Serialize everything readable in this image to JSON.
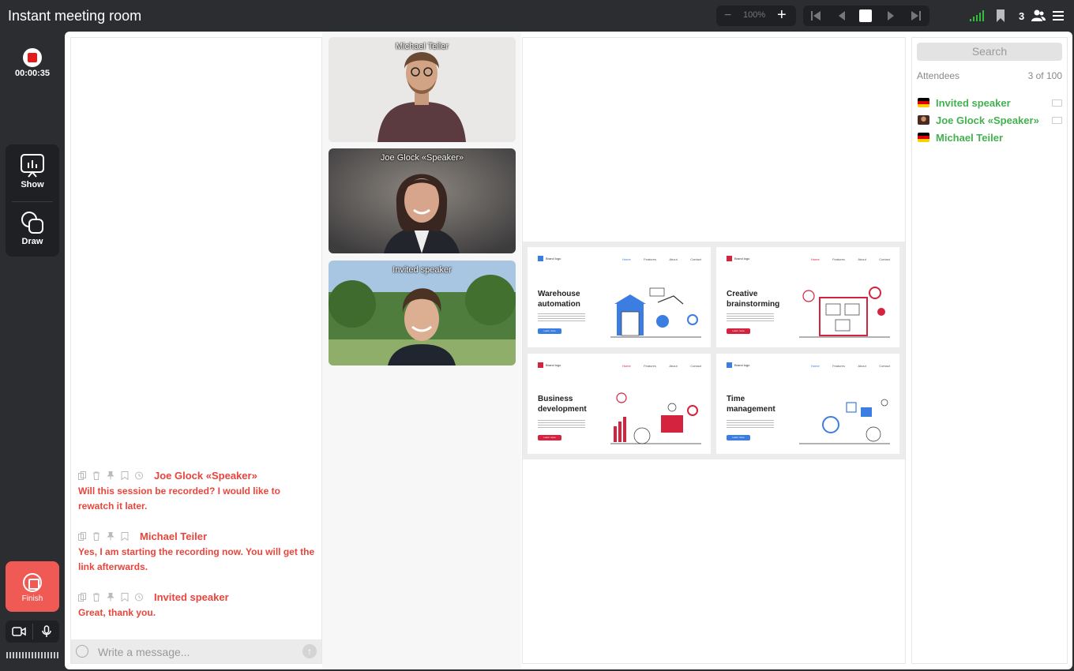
{
  "app": {
    "title": "Instant meeting room"
  },
  "toolbar": {
    "zoom_minus": "−",
    "zoom_value": "100%",
    "zoom_plus": "+",
    "participant_count": "3"
  },
  "left_rail": {
    "timer": "00:00:35",
    "show_label": "Show",
    "draw_label": "Draw",
    "finish_label": "Finish"
  },
  "chat": {
    "messages": [
      {
        "author": "Joe Glock «Speaker»",
        "text": "Will this session be recorded? I would like to rewatch it later."
      },
      {
        "author": "Michael Teiler",
        "text": "Yes, I am starting the recording now. You will get the link afterwards."
      },
      {
        "author": "Invited speaker",
        "text": "Great, thank you."
      }
    ],
    "input_placeholder": "Write a message..."
  },
  "videos": [
    {
      "name": "Michael Teiler"
    },
    {
      "name": "Joe Glock «Speaker»"
    },
    {
      "name": "Invited speaker"
    }
  ],
  "slides": [
    {
      "title": "Warehouse automation",
      "accent": "#3b7de1"
    },
    {
      "title": "Creative brainstorming",
      "accent": "#d4233f"
    },
    {
      "title": "Business development",
      "accent": "#d4233f"
    },
    {
      "title": "Time management",
      "accent": "#3b7de1"
    }
  ],
  "slide_common": {
    "logo": "Brand logo",
    "nav": [
      "Home",
      "Features",
      "About",
      "Contact"
    ],
    "button": "Learn more"
  },
  "attendees": {
    "search_placeholder": "Search",
    "label": "Attendees",
    "count": "3 of 100",
    "list": [
      {
        "name": "Invited speaker",
        "flag": "de"
      },
      {
        "name": "Joe Glock «Speaker»",
        "flag": "avatar"
      },
      {
        "name": "Michael Teiler",
        "flag": "de"
      }
    ]
  },
  "colors": {
    "chat_author": "#e8453c",
    "attendee_name": "#43b14f",
    "finish_button": "#ef5a55",
    "signal": "#2fbf3a"
  }
}
